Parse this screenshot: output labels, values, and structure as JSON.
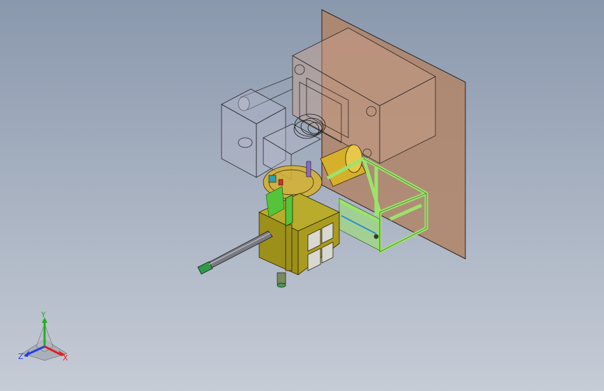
{
  "viewport": {
    "background_top": "#8a98ad",
    "background_bottom": "#c6ccd6"
  },
  "model": {
    "plate_color": "#b0856a",
    "mold_color": "#c9a08a",
    "frame_color": "#9be36b",
    "housing_color": "#a99b1f",
    "cylinder_color": "#d6b02b",
    "bracket_color": "#54c43a"
  },
  "triad": {
    "x_label": "X",
    "y_label": "Y",
    "z_label": "Z",
    "x_color": "#e02020",
    "y_color": "#20b020",
    "z_color": "#2040e0"
  }
}
